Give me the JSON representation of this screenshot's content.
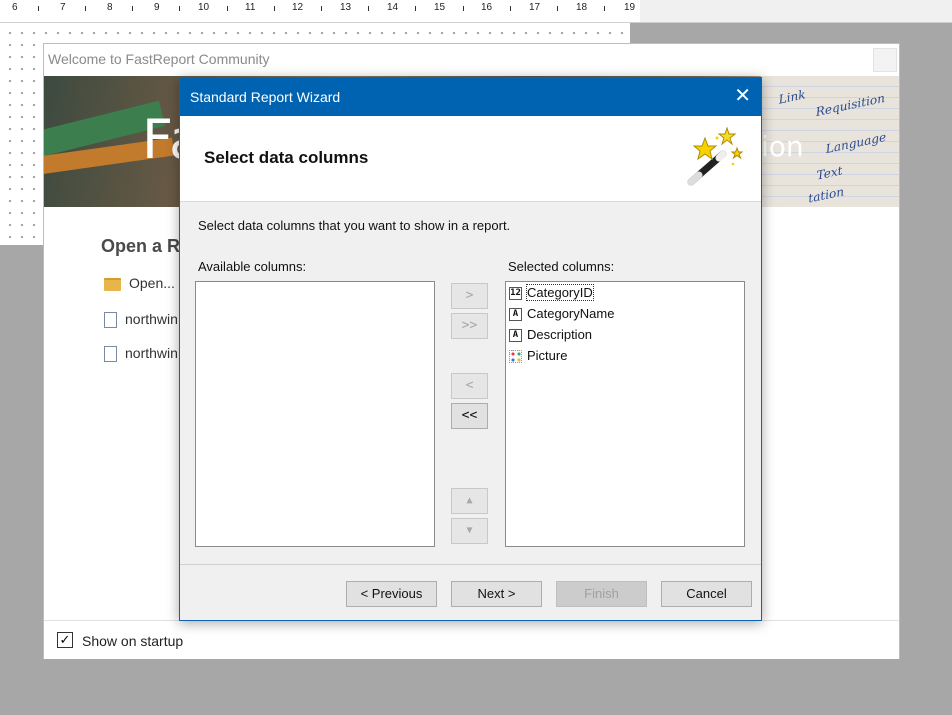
{
  "ruler": {
    "numbers": [
      "6",
      "7",
      "8",
      "9",
      "10",
      "11",
      "12",
      "13",
      "14",
      "15",
      "16",
      "17",
      "18",
      "19"
    ]
  },
  "welcome": {
    "title": "Welcome to FastReport Community",
    "banner_logo_fragment": "Fa",
    "banner_title_fragment": "ion",
    "banner_paper_words": [
      "Link",
      "Requisition",
      "Language",
      "Text",
      "tation"
    ],
    "open_heading": "Open a R",
    "recent_items": [
      {
        "label": "Open...",
        "icon": "folder-icon"
      },
      {
        "label": "northwin",
        "icon": "document-icon"
      },
      {
        "label": "northwin",
        "icon": "document-icon"
      }
    ],
    "show_on_startup_label": "Show on startup",
    "show_on_startup_checked": true
  },
  "wizard": {
    "title": "Standard Report Wizard",
    "close_glyph": "✕",
    "heading": "Select data columns",
    "description": "Select data columns that you want to show in a report.",
    "available_label": "Available columns:",
    "selected_label": "Selected columns:",
    "available_columns": [],
    "selected_columns": [
      {
        "name": "CategoryID",
        "type_glyph": "12",
        "icon": "numeric-type-icon"
      },
      {
        "name": "CategoryName",
        "type_glyph": "A",
        "icon": "text-type-icon"
      },
      {
        "name": "Description",
        "type_glyph": "A",
        "icon": "text-type-icon"
      },
      {
        "name": "Picture",
        "type_glyph": "",
        "icon": "picture-type-icon"
      }
    ],
    "move_buttons": {
      "add_one": ">",
      "add_all": ">>",
      "remove_one": "<",
      "remove_all": "<<",
      "move_up": "▲",
      "move_down": "▼"
    },
    "nav_buttons": {
      "previous": "< Previous",
      "next": "Next >",
      "finish": "Finish",
      "cancel": "Cancel"
    }
  }
}
